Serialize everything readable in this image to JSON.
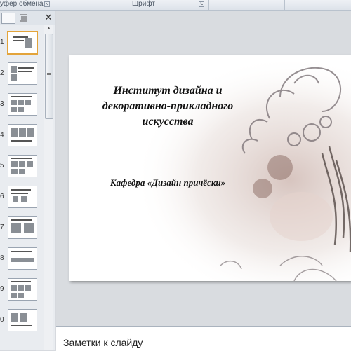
{
  "ribbon": {
    "clipboard_label": "уфер обмена",
    "font_label": "Шрифт"
  },
  "thumbnails": {
    "numbers": [
      "1",
      "2",
      "3",
      "4",
      "5",
      "6",
      "7",
      "8",
      "9",
      "0"
    ],
    "selected": "1"
  },
  "slide": {
    "title": "Институт дизайна и декоративно-прикладного искусства",
    "subtitle": "Кафедра «Дизайн причёски»"
  },
  "notes": {
    "placeholder": "Заметки к слайду"
  },
  "colors": {
    "selection": "#e3a43b",
    "workspace": "#d9dce0"
  }
}
